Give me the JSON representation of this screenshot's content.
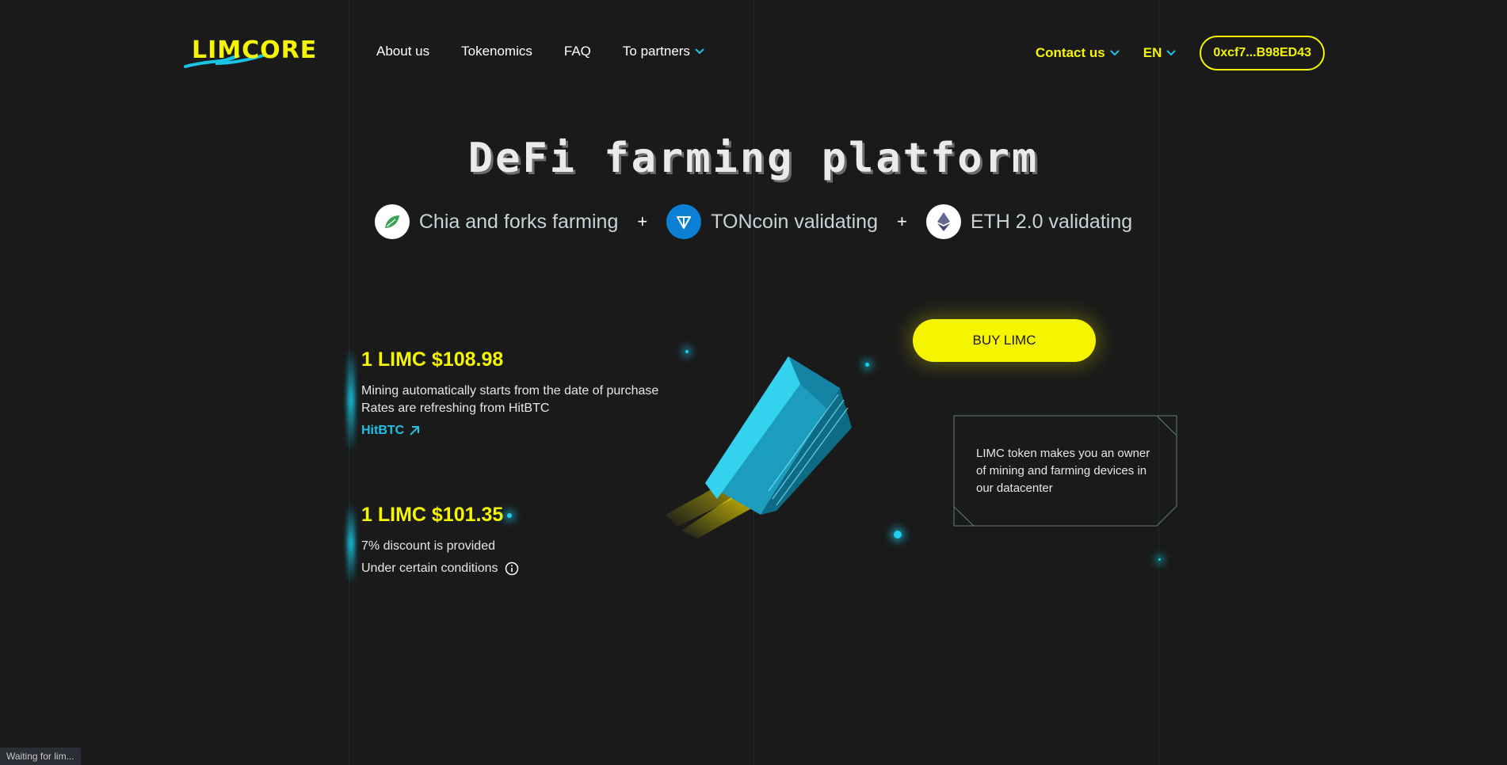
{
  "header": {
    "logo_text": "LIMCORE",
    "nav": [
      {
        "label": "About us"
      },
      {
        "label": "Tokenomics"
      },
      {
        "label": "FAQ"
      },
      {
        "label": "To partners",
        "has_dropdown": true
      }
    ],
    "contact_label": "Contact us",
    "lang_label": "EN",
    "wallet_label": "0xcf7...B98ED43"
  },
  "hero": {
    "title": "DeFi farming platform",
    "features": [
      {
        "label": "Chia and forks farming",
        "icon": "chia-leaf-icon"
      },
      {
        "label": "TONcoin validating",
        "icon": "ton-icon"
      },
      {
        "label": "ETH 2.0 validating",
        "icon": "eth-icon"
      }
    ],
    "plus": "+"
  },
  "prices": [
    {
      "price": "1 LIMC $108.98",
      "line1": "Mining automatically starts from the date of purchase",
      "line2": "Rates are refreshing from HitBTC",
      "link": "HitBTC"
    },
    {
      "price": "1 LIMC $101.35",
      "line1": "7% discount is provided",
      "line2": "Under certain conditions"
    }
  ],
  "buy_label": "BUY LIMC",
  "info_card_text": "LIMC token makes you an owner of mining and farming devices in our datacenter",
  "status_text": "Waiting for lim...",
  "colors": {
    "background": "#1a1a1a",
    "accent_yellow": "#f5f500",
    "accent_cyan": "#1bc3e6",
    "ton_blue": "#0b7fd4"
  }
}
